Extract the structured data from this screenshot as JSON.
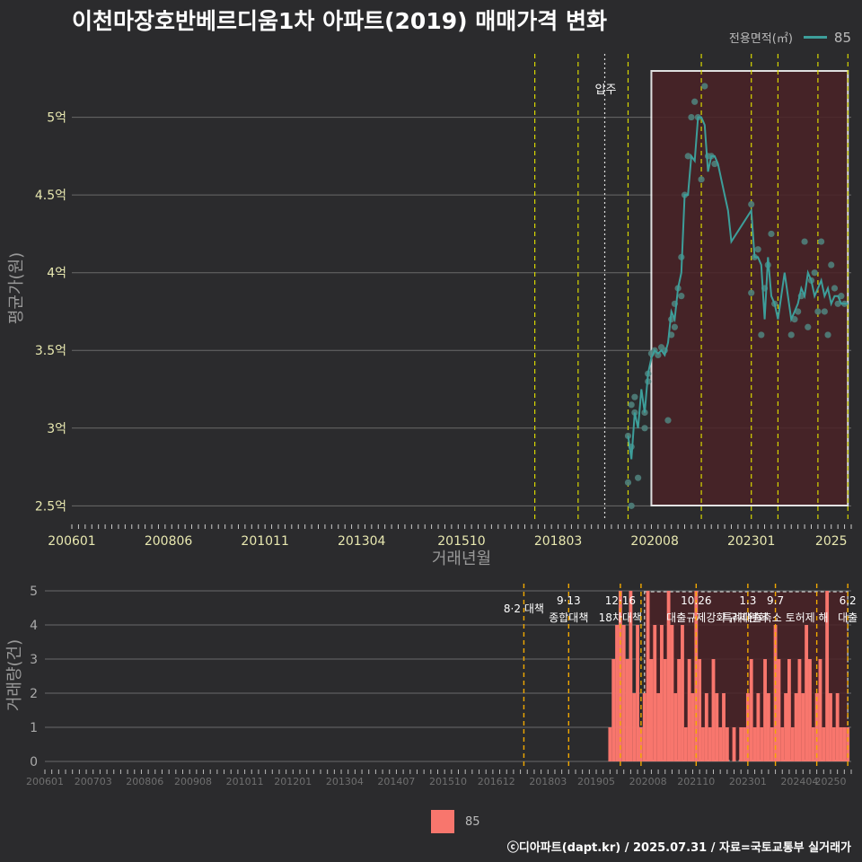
{
  "title": "이천마장호반베르디움1차 아파트(2019) 매매가격 변화",
  "legend": {
    "label": "전용면적(㎡)",
    "value": "85"
  },
  "legend_bottom": {
    "value": "85"
  },
  "credit": "ⓒ디아파트(dapt.kr) / 2025.07.31 / 자료=국토교통부 실거래가",
  "colors": {
    "line": "#3d9e9a",
    "bar": "#f8766d",
    "highlight": "#4a2226",
    "policy": "#d8d800",
    "policy_bottom": "#f2a900"
  },
  "chart_data": [
    {
      "type": "line",
      "ylabel": "평균가(원)",
      "xlabel": "거래년월",
      "x_ticks": [
        "200601",
        "200806",
        "201011",
        "201304",
        "201510",
        "201803",
        "202008",
        "202301",
        "2025"
      ],
      "y_ticks": [
        "2.5억",
        "3억",
        "3.5억",
        "4억",
        "4.5억",
        "5억"
      ],
      "ylim": [
        2.45,
        5.35
      ],
      "annotation": "입주",
      "annotation_x": "2019-05",
      "policy_lines": [
        "2017-08",
        "2018-09",
        "2019-12",
        "2021-10",
        "2023-01",
        "2023-09",
        "2024-09",
        "2025-06"
      ],
      "highlight_range": [
        "2020-07",
        "2025-06"
      ],
      "series": [
        {
          "name": "85",
          "x": [
            "2019-12",
            "2020-01",
            "2020-02",
            "2020-03",
            "2020-04",
            "2020-05",
            "2020-06",
            "2020-07",
            "2020-08",
            "2020-09",
            "2020-10",
            "2020-11",
            "2020-12",
            "2021-01",
            "2021-02",
            "2021-03",
            "2021-04",
            "2021-05",
            "2021-06",
            "2021-07",
            "2021-08",
            "2021-09",
            "2021-10",
            "2021-11",
            "2021-12",
            "2022-01",
            "2022-02",
            "2022-03",
            "2022-04",
            "2022-05",
            "2022-06",
            "2022-07",
            "2023-01",
            "2023-02",
            "2023-03",
            "2023-04",
            "2023-05",
            "2023-06",
            "2023-07",
            "2023-08",
            "2023-09",
            "2023-10",
            "2023-11",
            "2024-01",
            "2024-02",
            "2024-03",
            "2024-04",
            "2024-05",
            "2024-06",
            "2024-07",
            "2024-08",
            "2024-09",
            "2024-10",
            "2024-11",
            "2024-12",
            "2025-01",
            "2025-02",
            "2025-03",
            "2025-04",
            "2025-05",
            "2025-06"
          ],
          "values": [
            2.95,
            2.8,
            3.1,
            3.0,
            3.25,
            3.1,
            3.35,
            3.45,
            3.5,
            3.48,
            3.5,
            3.47,
            3.55,
            3.75,
            3.7,
            3.9,
            4.0,
            4.5,
            4.5,
            4.75,
            4.72,
            5.0,
            5.0,
            4.95,
            4.65,
            4.75,
            4.75,
            4.7,
            4.6,
            4.5,
            4.4,
            4.2,
            4.4,
            4.1,
            4.1,
            4.05,
            3.7,
            4.1,
            3.85,
            3.8,
            3.7,
            3.85,
            4.0,
            3.7,
            3.75,
            3.8,
            3.9,
            3.85,
            4.0,
            3.95,
            3.85,
            3.9,
            3.95,
            3.85,
            3.9,
            3.8,
            3.85,
            3.85,
            3.8,
            3.8,
            3.8
          ]
        }
      ],
      "scatter_x": [
        "2019-12",
        "2019-12",
        "2020-01",
        "2020-01",
        "2020-01",
        "2020-02",
        "2020-02",
        "2020-03",
        "2020-05",
        "2020-05",
        "2020-06",
        "2020-06",
        "2020-07",
        "2020-08",
        "2020-09",
        "2020-10",
        "2020-11",
        "2020-12",
        "2021-01",
        "2021-01",
        "2021-02",
        "2021-02",
        "2021-03",
        "2021-04",
        "2021-04",
        "2021-05",
        "2021-06",
        "2021-07",
        "2021-08",
        "2021-09",
        "2021-10",
        "2021-11",
        "2021-12",
        "2022-01",
        "2022-02",
        "2023-01",
        "2023-01",
        "2023-02",
        "2023-03",
        "2023-04",
        "2023-05",
        "2023-06",
        "2023-07",
        "2023-08",
        "2024-01",
        "2024-02",
        "2024-03",
        "2024-04",
        "2024-05",
        "2024-06",
        "2024-07",
        "2024-08",
        "2024-09",
        "2024-10",
        "2024-11",
        "2024-12",
        "2025-01",
        "2025-02",
        "2025-03",
        "2025-04",
        "2025-05"
      ],
      "scatter_y": [
        2.95,
        2.65,
        2.5,
        2.88,
        3.15,
        3.2,
        3.1,
        2.68,
        3.1,
        3.0,
        3.35,
        3.3,
        3.48,
        3.5,
        3.47,
        3.52,
        3.5,
        3.05,
        3.7,
        3.6,
        3.65,
        3.8,
        3.9,
        3.85,
        4.1,
        4.5,
        4.75,
        5.0,
        5.1,
        5.0,
        4.6,
        5.2,
        4.75,
        4.75,
        4.7,
        4.44,
        3.87,
        4.1,
        4.15,
        3.6,
        3.9,
        4.05,
        4.25,
        3.8,
        3.6,
        3.7,
        3.75,
        3.85,
        4.2,
        3.65,
        3.95,
        4.0,
        3.75,
        4.2,
        3.75,
        3.6,
        4.05,
        3.9,
        3.8,
        3.85,
        3.8
      ]
    },
    {
      "type": "bar",
      "ylabel": "거래량(건)",
      "x_ticks": [
        "200601",
        "200703",
        "200806",
        "200908",
        "201011",
        "201201",
        "201304",
        "201407",
        "201510",
        "201612",
        "201803",
        "201905",
        "202008",
        "202110",
        "202301",
        "202404",
        "20250"
      ],
      "y_ticks": [
        "0",
        "1",
        "2",
        "3",
        "4",
        "5"
      ],
      "ylim": [
        0,
        5
      ],
      "highlight_range": [
        "2020-07",
        "2025-06"
      ],
      "policies": [
        {
          "date": "2017-08",
          "label": "8·2 대책",
          "line1": "",
          "line2": "8·2 대책"
        },
        {
          "date": "2018-09",
          "label": "9·13 종합대책",
          "line1": "9·13",
          "line2": "종합대책"
        },
        {
          "date": "2019-12",
          "label": "12·16 18차대책",
          "line1": "12·16",
          "line2": "18차대책"
        },
        {
          "date": "2020-06",
          "label": "",
          "line1": "",
          "line2": ""
        },
        {
          "date": "2021-10",
          "label": "10.26 대출규제강화",
          "line1": "10.26",
          "line2": "대출규제강화"
        },
        {
          "date": "2023-01",
          "label": "1.3 규제완화",
          "line1": "1.3",
          "line2": "규제완화"
        },
        {
          "date": "2023-09",
          "label": "9.7 특례대출축소 토허제 해",
          "line1": "9.7",
          "line2": "특례대출축소 토허제 해"
        },
        {
          "date": "2024-09",
          "label": "",
          "line1": "",
          "line2": ""
        },
        {
          "date": "2025-06",
          "label": "6.2 대출",
          "line1": "6.2",
          "line2": "대출"
        }
      ],
      "x": [
        "2019-09",
        "2019-10",
        "2019-11",
        "2019-12",
        "2020-01",
        "2020-02",
        "2020-03",
        "2020-04",
        "2020-05",
        "2020-06",
        "2020-07",
        "2020-08",
        "2020-09",
        "2020-10",
        "2020-11",
        "2020-12",
        "2021-01",
        "2021-02",
        "2021-03",
        "2021-04",
        "2021-05",
        "2021-06",
        "2021-07",
        "2021-08",
        "2021-09",
        "2021-10",
        "2021-11",
        "2021-12",
        "2022-01",
        "2022-02",
        "2022-03",
        "2022-04",
        "2022-05",
        "2022-06",
        "2022-07",
        "2022-08",
        "2022-09",
        "2022-10",
        "2022-11",
        "2022-12",
        "2023-01",
        "2023-02",
        "2023-03",
        "2023-04",
        "2023-05",
        "2023-06",
        "2023-07",
        "2023-08",
        "2023-09",
        "2023-10",
        "2023-11",
        "2023-12",
        "2024-01",
        "2024-02",
        "2024-03",
        "2024-04",
        "2024-05",
        "2024-06",
        "2024-07",
        "2024-08",
        "2024-09",
        "2024-10",
        "2024-11",
        "2024-12",
        "2025-01",
        "2025-02",
        "2025-03",
        "2025-04",
        "2025-05",
        "2025-06"
      ],
      "values": [
        1,
        3,
        4,
        5,
        4,
        3,
        5,
        2,
        4,
        1,
        2,
        5,
        3,
        4,
        2,
        4,
        3,
        5,
        4,
        2,
        3,
        4,
        1,
        3,
        2,
        5,
        3,
        1,
        2,
        1,
        3,
        2,
        1,
        2,
        1,
        0,
        1,
        0,
        1,
        1,
        2,
        3,
        1,
        2,
        1,
        3,
        2,
        1,
        4,
        3,
        1,
        2,
        3,
        1,
        2,
        3,
        2,
        4,
        3,
        1,
        2,
        3,
        1,
        5,
        2,
        1,
        2,
        1,
        1,
        1
      ]
    }
  ]
}
